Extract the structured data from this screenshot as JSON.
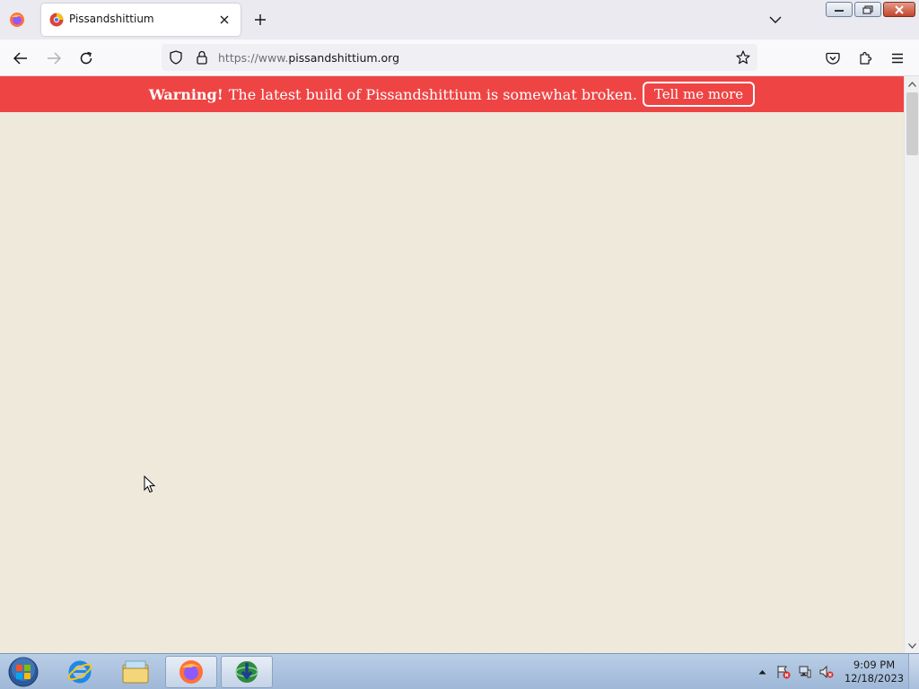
{
  "browser": {
    "tab": {
      "title": "Pissandshittium"
    },
    "url": {
      "prefix": "https://www.",
      "domain": "pissandshittium.org"
    }
  },
  "page": {
    "banner": {
      "strong": "Warning!",
      "message": "The latest build of Pissandshittium is somewhat broken.",
      "button": "Tell me more"
    }
  },
  "taskbar": {
    "apps": [
      "Internet Explorer",
      "Windows Explorer",
      "Firefox",
      "Internet Download Manager"
    ],
    "clock": {
      "time": "9:09 PM",
      "date": "12/18/2023"
    }
  },
  "colors": {
    "banner_bg": "#ef4444",
    "page_bg": "#eee9da"
  }
}
